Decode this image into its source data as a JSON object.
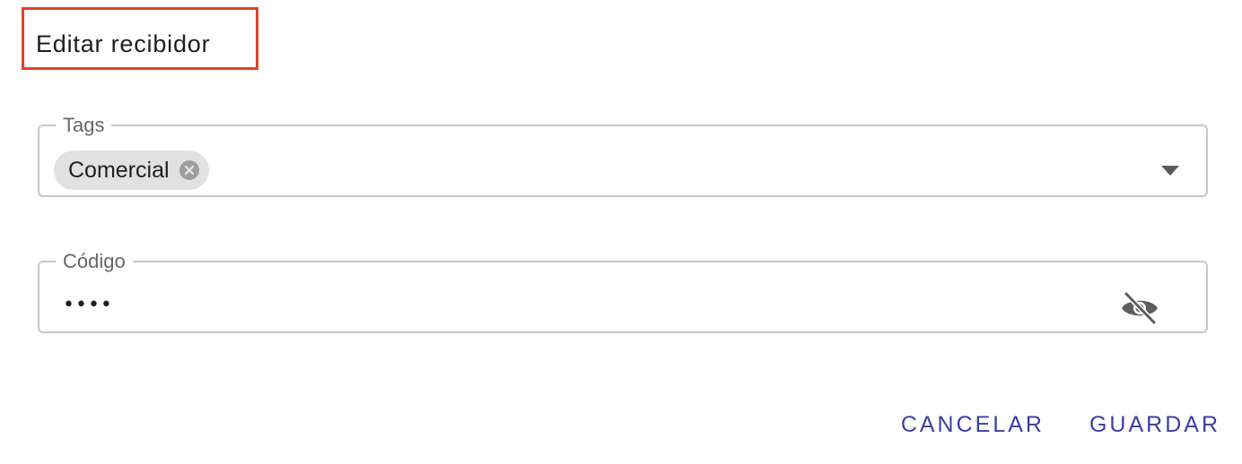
{
  "dialog": {
    "title": "Editar recibidor"
  },
  "tags_field": {
    "label": "Tags",
    "chips": [
      {
        "label": "Comercial"
      }
    ],
    "icons": {
      "remove": "close-circle-icon",
      "dropdown": "arrow-drop-down-icon"
    }
  },
  "code_field": {
    "label": "Código",
    "value": "••••",
    "icons": {
      "visibility": "visibility-off-icon"
    }
  },
  "actions": {
    "cancel_label": "CANCELAR",
    "save_label": "GUARDAR"
  },
  "colors": {
    "highlight_border": "#e0412a",
    "button_text": "#3d3fa0",
    "chip_background": "#e1e1e1",
    "field_border": "#c8c8c8"
  }
}
